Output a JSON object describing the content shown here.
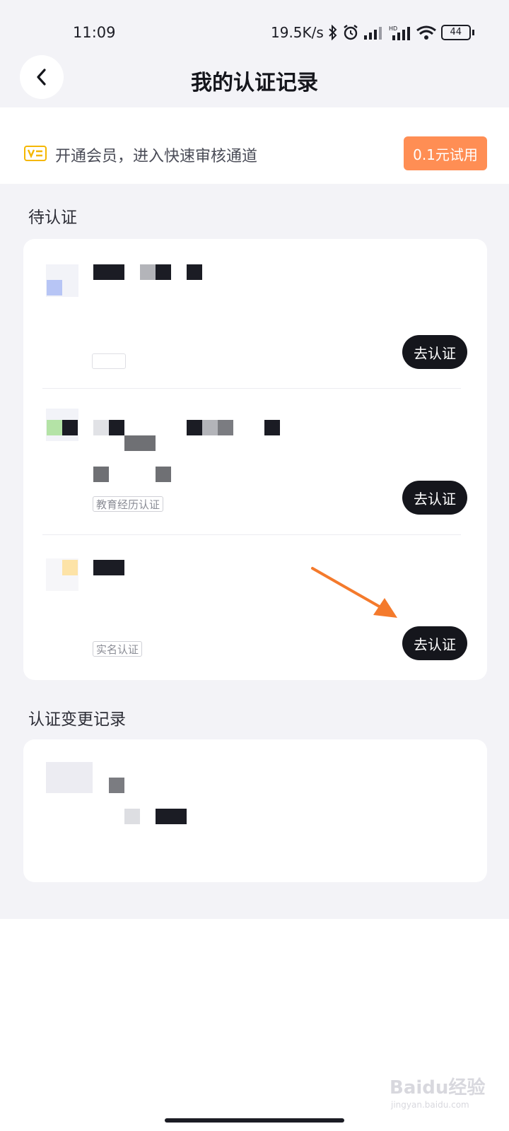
{
  "status_bar": {
    "time": "11:09",
    "network_speed": "19.5K/s",
    "icons": [
      "bluetooth-icon",
      "alarm-icon",
      "signal-icon",
      "hd-signal-icon",
      "wifi-icon",
      "battery-icon"
    ],
    "battery": "44"
  },
  "header": {
    "title": "我的认证记录",
    "back_icon": "chevron-left-icon"
  },
  "promo": {
    "icon": "vip-icon",
    "text": "开通会员，进入快速审核通道",
    "button": "0.1元试用"
  },
  "pending": {
    "section_title": "待认证",
    "items": [
      {
        "tag": "",
        "button": "去认证"
      },
      {
        "tag": "教育经历认证",
        "button": "去认证"
      },
      {
        "tag": "实名认证",
        "button": "去认证"
      }
    ]
  },
  "changes": {
    "section_title": "认证变更记录"
  },
  "watermark": {
    "brand": "Baidu经验",
    "url": "jingyan.baidu.com"
  },
  "colors": {
    "accent_orange": "#ff8e54",
    "cta_dark": "#15161c",
    "page_gray": "#f3f3f7",
    "vip_yellow": "#f5b700",
    "arrow_orange": "#f47a2c"
  }
}
